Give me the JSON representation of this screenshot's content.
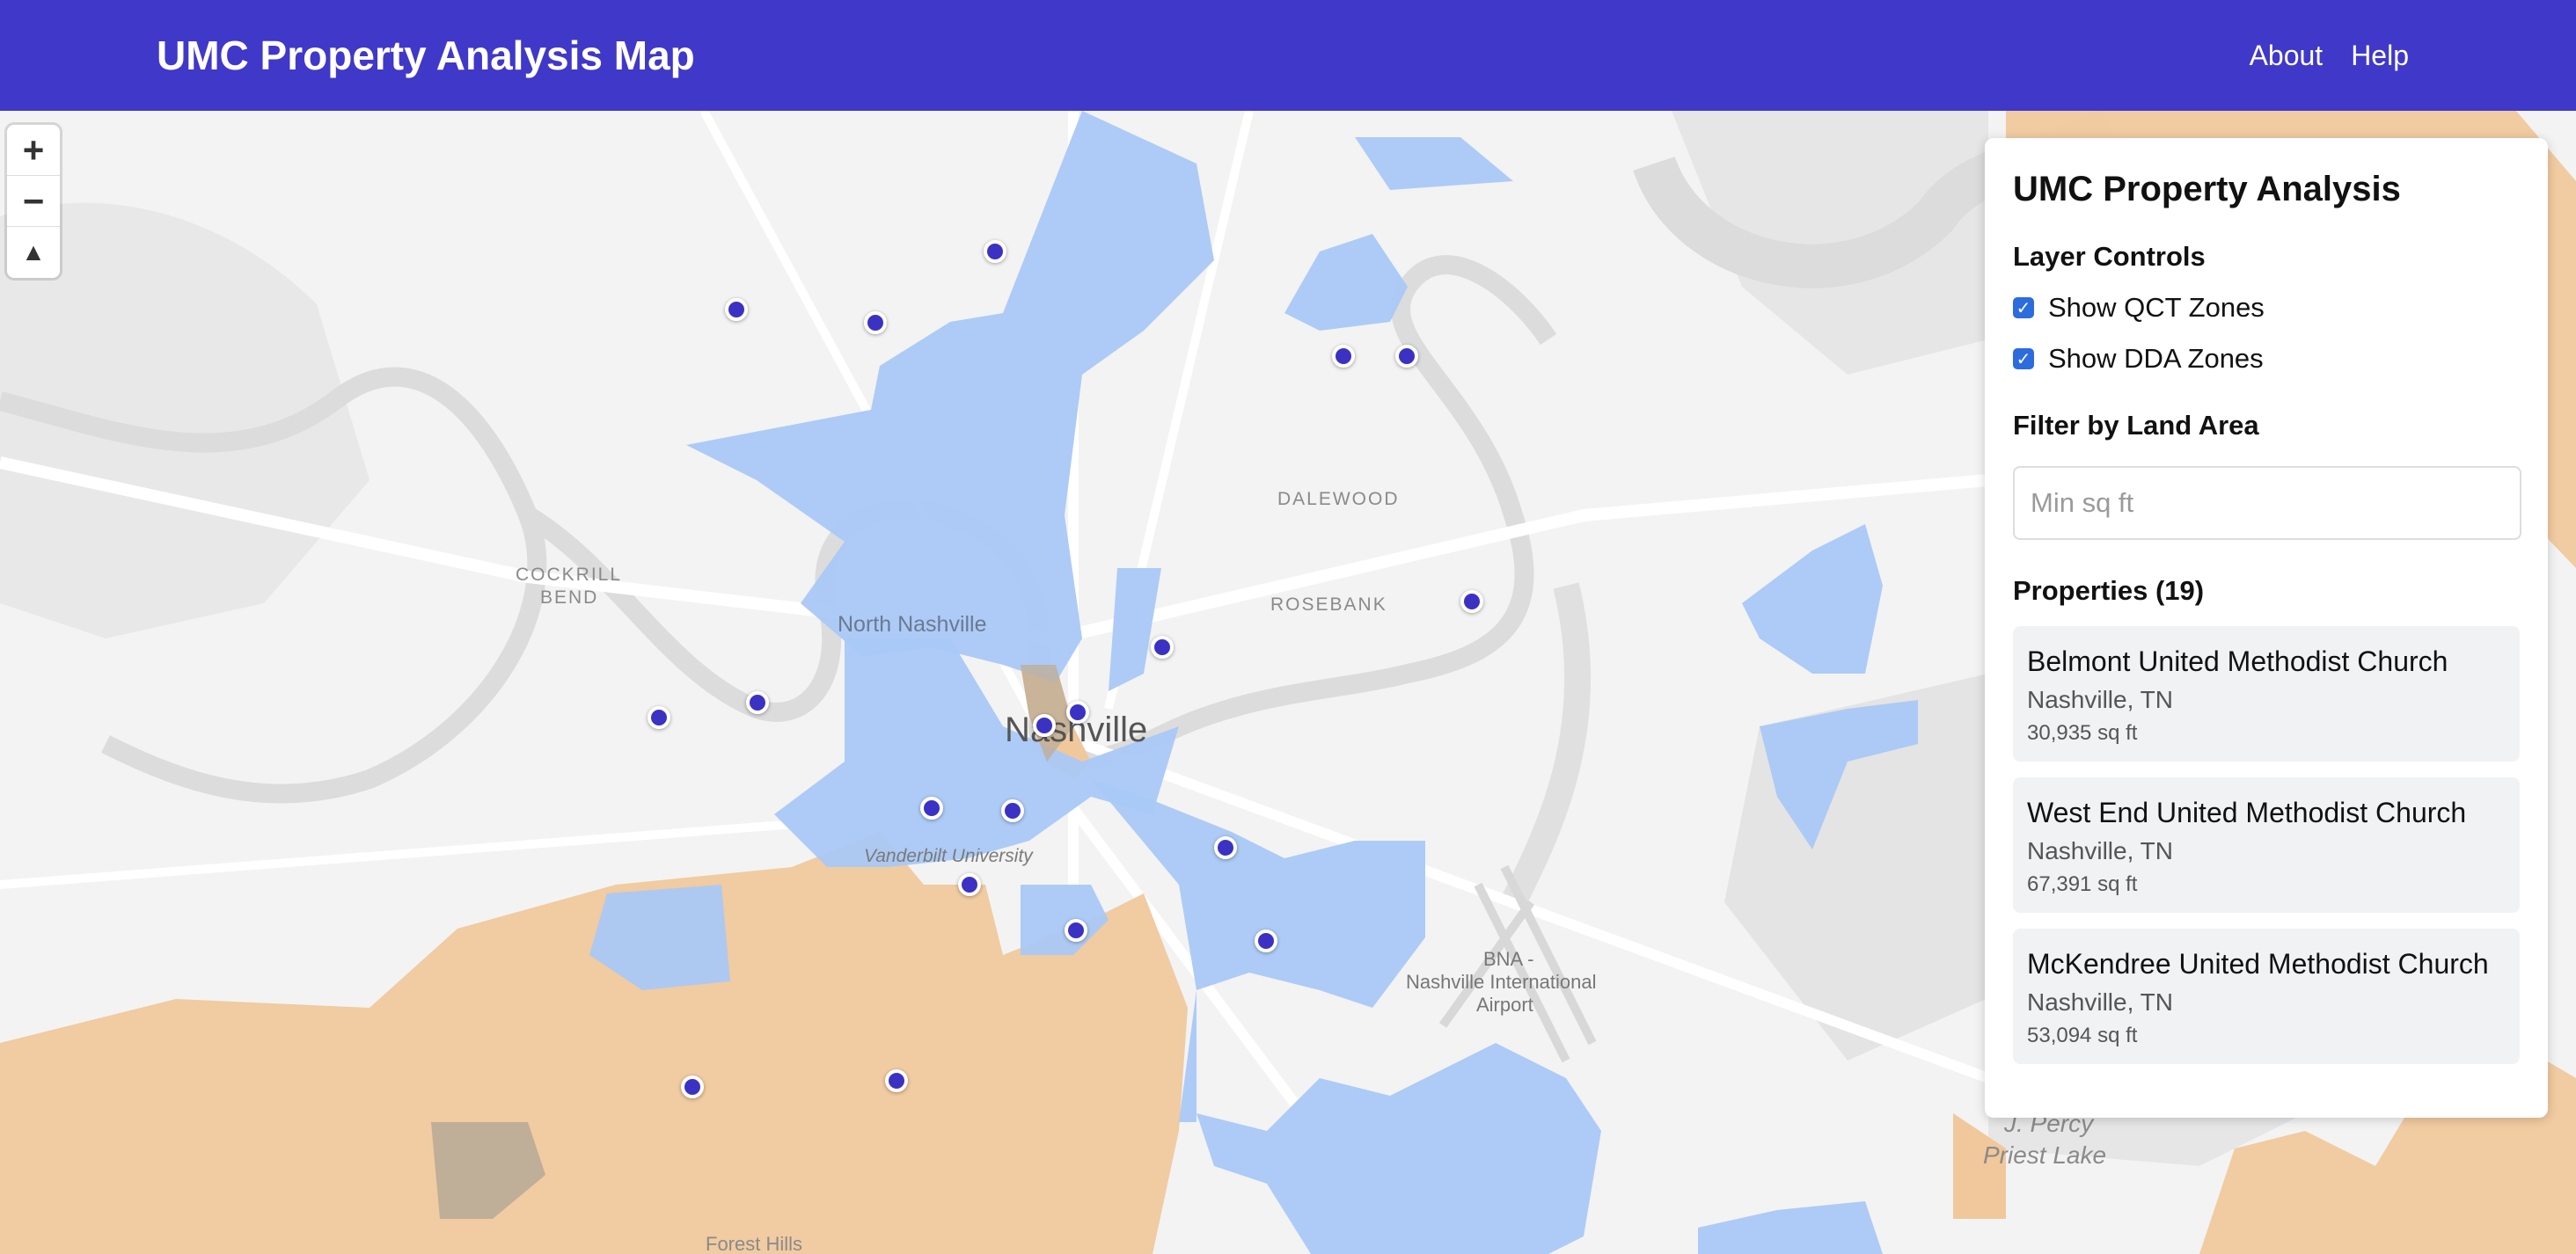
{
  "header": {
    "title": "UMC Property Analysis Map",
    "links": [
      "About",
      "Help"
    ]
  },
  "map": {
    "zoom_in": "+",
    "zoom_out": "−",
    "compass": "▲",
    "labels": {
      "city": "Nashville",
      "north_nashville": "North Nashville",
      "vanderbilt": "Vanderbilt University",
      "dalewood": "DALEWOOD",
      "rosebank": "ROSEBANK",
      "cockrill_1": "COCKRILL",
      "cockrill_2": "BEND",
      "airport_1": "BNA -",
      "airport_2": "Nashville International",
      "airport_3": "Airport",
      "lake_1": "J. Percy",
      "lake_2": "Priest Lake",
      "forest_hills": "Forest Hills"
    },
    "colors": {
      "qct_fill": "#a9c8f5",
      "dda_fill": "#f0c89c",
      "marker": "#3b32c4",
      "water": "#dedede",
      "navbar": "#4038c8"
    }
  },
  "panel": {
    "title": "UMC Property Analysis",
    "layer_heading": "Layer Controls",
    "show_qct": "Show QCT Zones",
    "show_dda": "Show DDA Zones",
    "filter_heading": "Filter by Land Area",
    "min_placeholder": "Min sq ft",
    "properties_heading": "Properties (19)",
    "properties": [
      {
        "name": "Belmont United Methodist Church",
        "city": "Nashville, TN",
        "area": "30,935 sq ft"
      },
      {
        "name": "West End United Methodist Church",
        "city": "Nashville, TN",
        "area": "67,391 sq ft"
      },
      {
        "name": "McKendree United Methodist Church",
        "city": "Nashville, TN",
        "area": "53,094 sq ft"
      }
    ]
  }
}
